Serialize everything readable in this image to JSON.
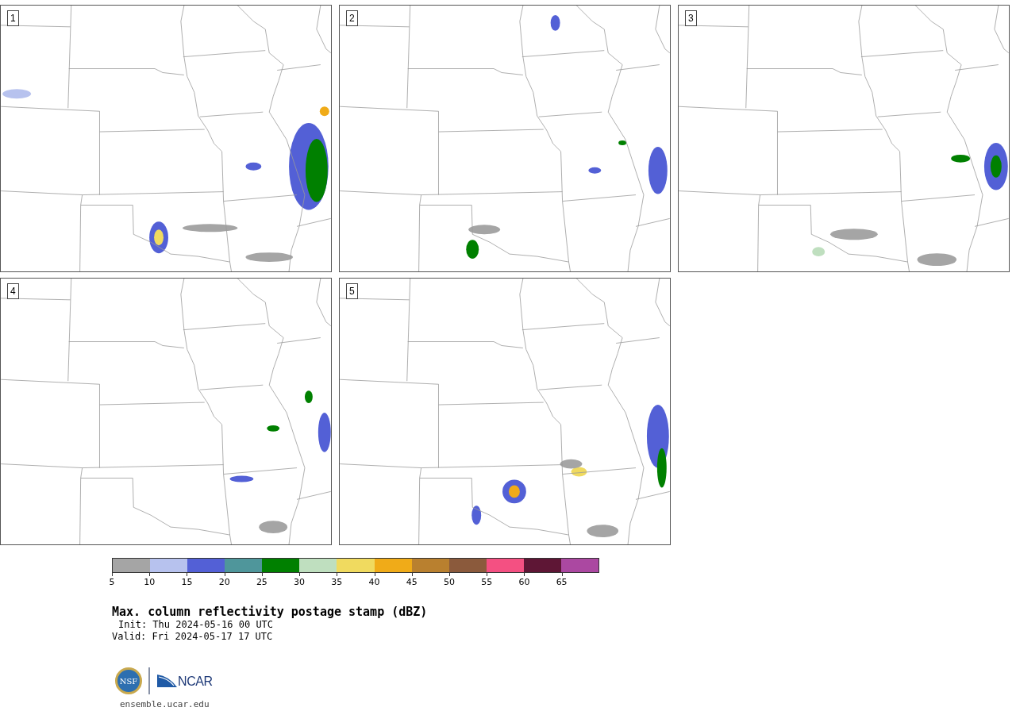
{
  "panels": [
    {
      "label": "1"
    },
    {
      "label": "2"
    },
    {
      "label": "3"
    },
    {
      "label": "4"
    },
    {
      "label": "5"
    }
  ],
  "colorbar": {
    "segments": [
      {
        "color": "#a5a5a5"
      },
      {
        "color": "#b7c2ee"
      },
      {
        "color": "#5360d6"
      },
      {
        "color": "#4f969b"
      },
      {
        "color": "#008000"
      },
      {
        "color": "#bfdfbf"
      },
      {
        "color": "#f0da5f"
      },
      {
        "color": "#f0ab18"
      },
      {
        "color": "#b9802f"
      },
      {
        "color": "#8b5a3c"
      },
      {
        "color": "#f45082"
      },
      {
        "color": "#5e1635"
      },
      {
        "color": "#ab48a1"
      }
    ],
    "ticks": [
      "5",
      "10",
      "15",
      "20",
      "25",
      "30",
      "35",
      "40",
      "45",
      "50",
      "55",
      "60",
      "65"
    ]
  },
  "title": "Max. column reflectivity postage stamp (dBZ)",
  "init": "Init: Thu 2024-05-16 00 UTC",
  "valid": "Valid: Fri 2024-05-17 17 UTC",
  "logos": {
    "nsf": "NSF",
    "ncar": "NCAR"
  },
  "footer": "ensemble.ucar.edu"
}
